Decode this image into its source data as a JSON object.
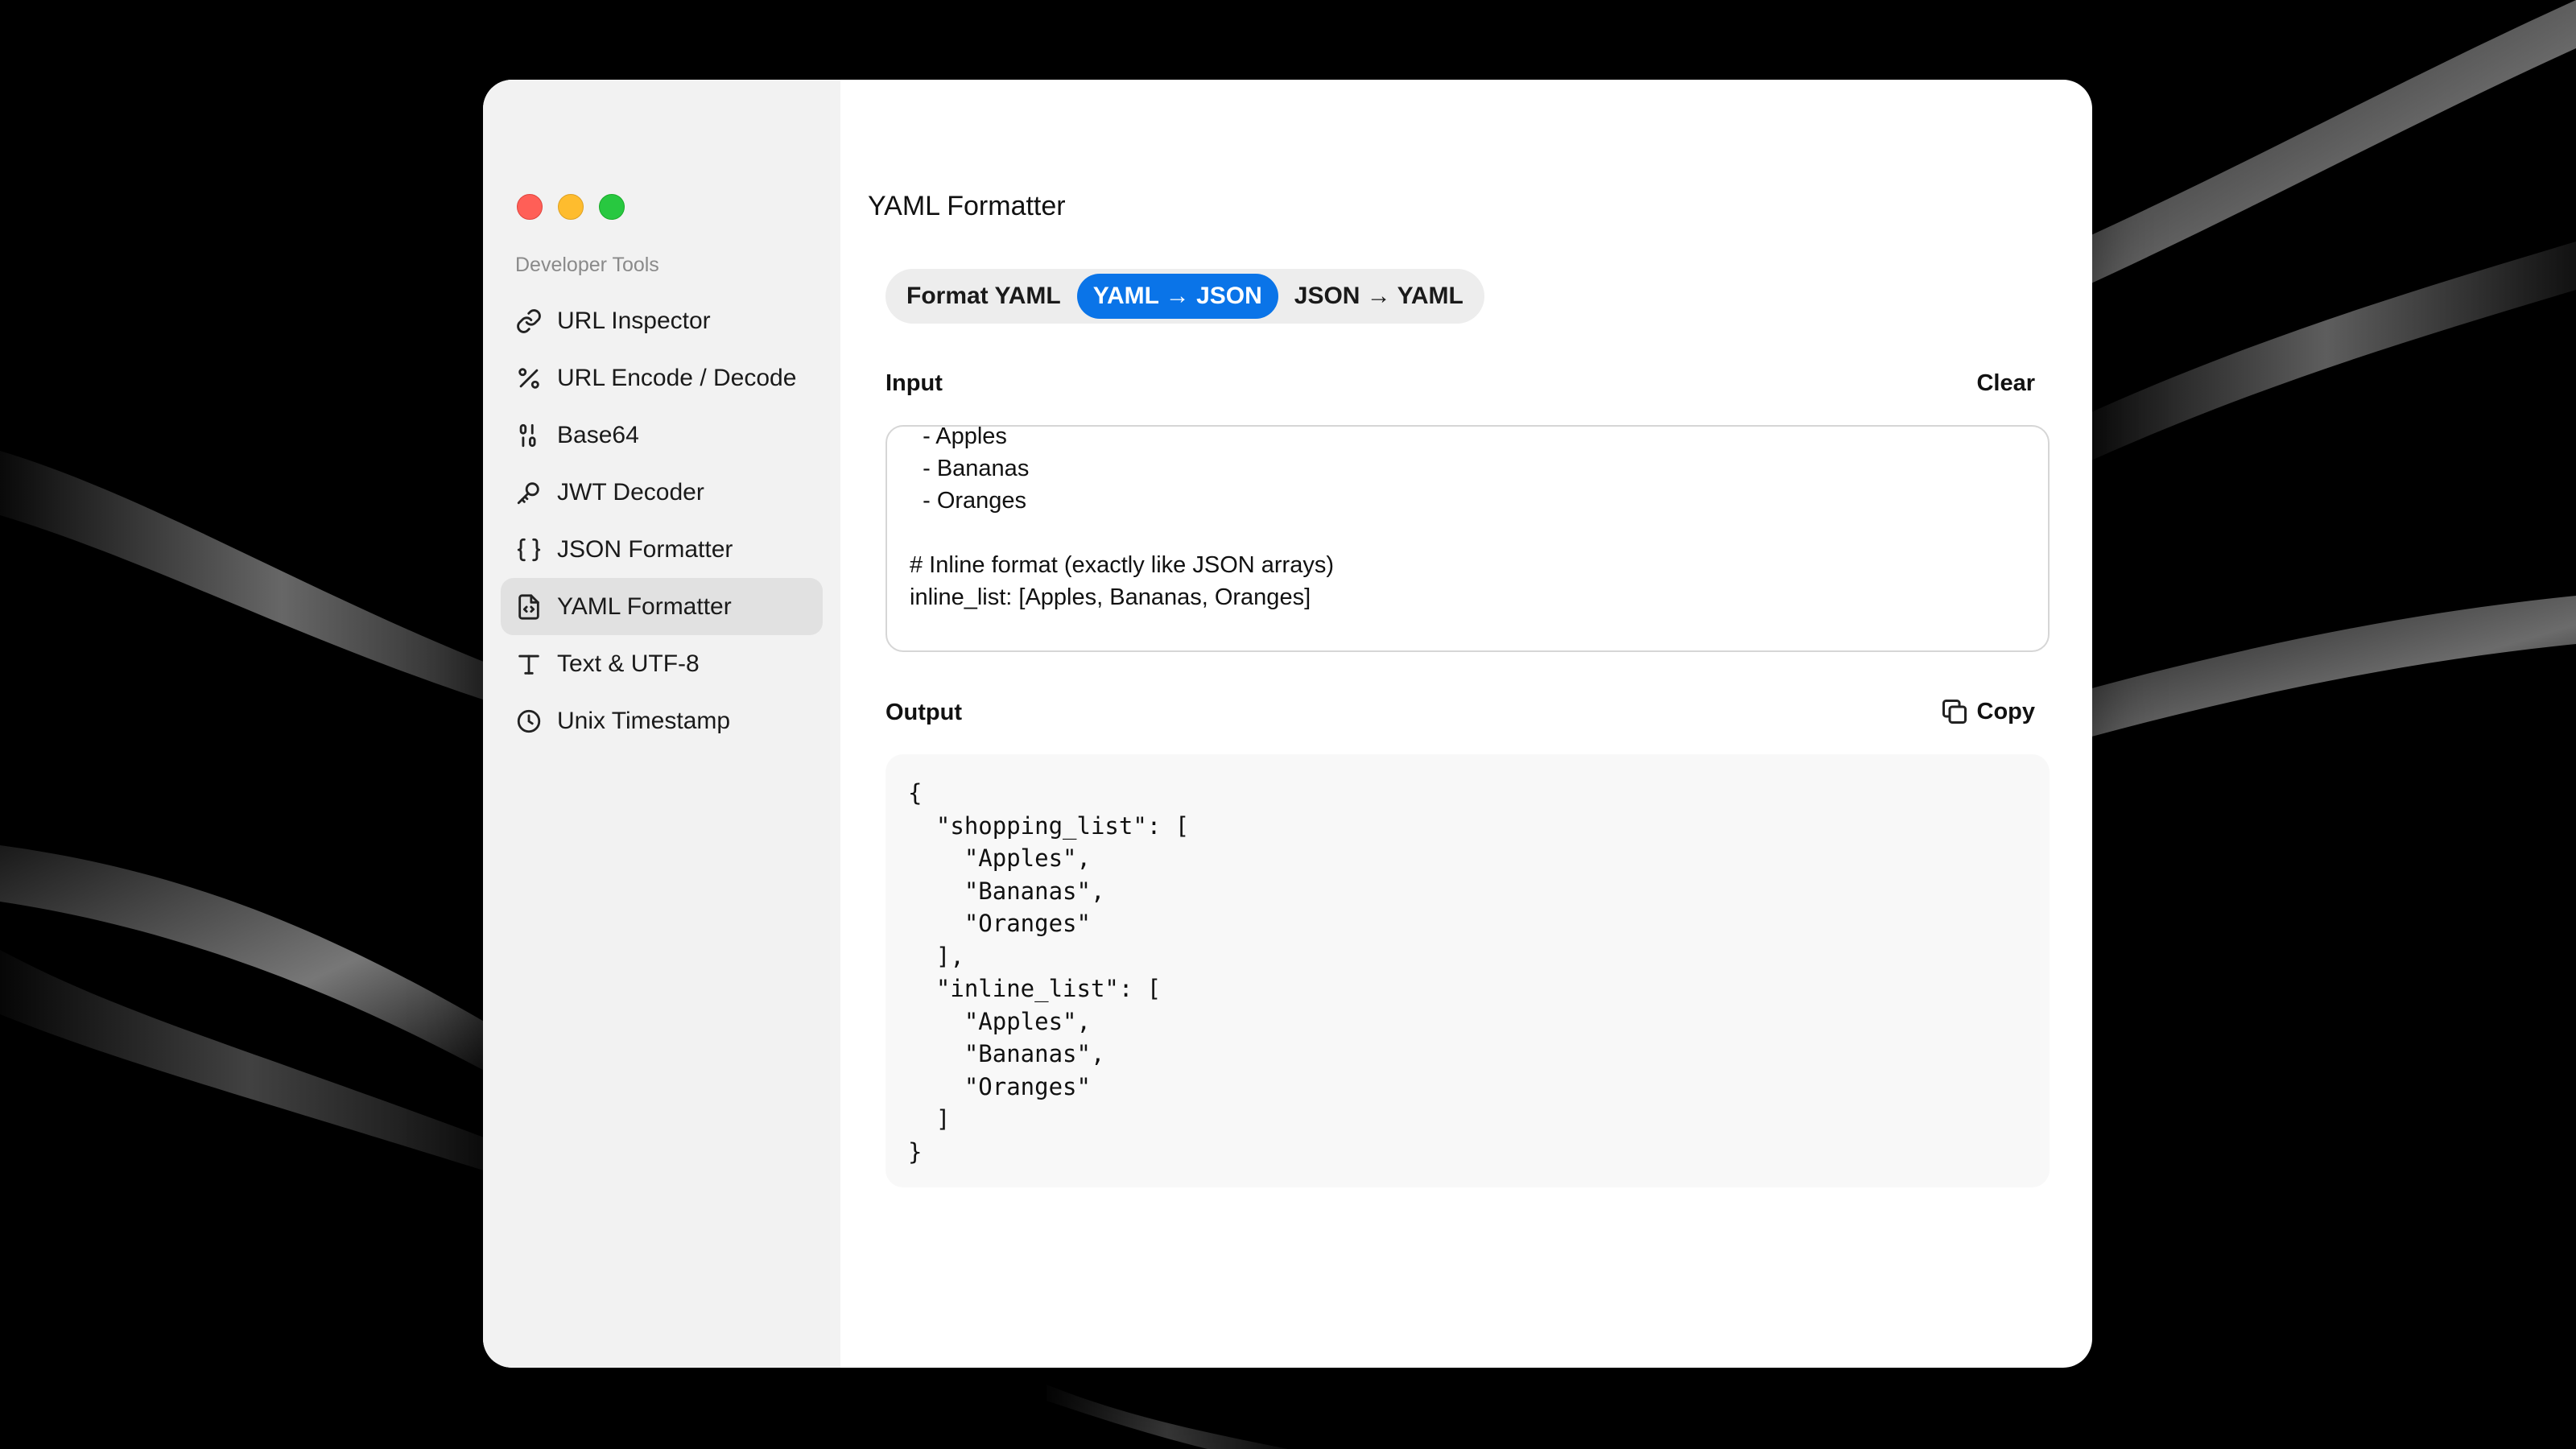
{
  "window": {
    "title": "YAML Formatter",
    "traffic_lights": {
      "close": "#ff5f57",
      "minimize": "#febc2e",
      "zoom": "#28c840"
    }
  },
  "sidebar": {
    "section_title": "Developer Tools",
    "items": [
      {
        "label": "URL Inspector",
        "icon": "link-icon",
        "active": false
      },
      {
        "label": "URL Encode / Decode",
        "icon": "percent-icon",
        "active": false
      },
      {
        "label": "Base64",
        "icon": "binary-icon",
        "active": false
      },
      {
        "label": "JWT Decoder",
        "icon": "key-icon",
        "active": false
      },
      {
        "label": "JSON Formatter",
        "icon": "braces-icon",
        "active": false
      },
      {
        "label": "YAML Formatter",
        "icon": "file-code-icon",
        "active": true
      },
      {
        "label": "Text & UTF-8",
        "icon": "type-icon",
        "active": false
      },
      {
        "label": "Unix Timestamp",
        "icon": "clock-icon",
        "active": false
      }
    ]
  },
  "modes": {
    "options": [
      "Format YAML",
      "YAML → JSON",
      "JSON → YAML"
    ],
    "selected": "YAML → JSON",
    "accent_color": "#0a74e8"
  },
  "input": {
    "label": "Input",
    "clear_label": "Clear",
    "value": "  - Apples\n  - Bananas\n  - Oranges\n\n# Inline format (exactly like JSON arrays)\ninline_list: [Apples, Bananas, Oranges]"
  },
  "output": {
    "label": "Output",
    "copy_label": "Copy",
    "copy_icon": "copy-icon",
    "value": "{\n  \"shopping_list\": [\n    \"Apples\",\n    \"Bananas\",\n    \"Oranges\"\n  ],\n  \"inline_list\": [\n    \"Apples\",\n    \"Bananas\",\n    \"Oranges\"\n  ]\n}"
  }
}
